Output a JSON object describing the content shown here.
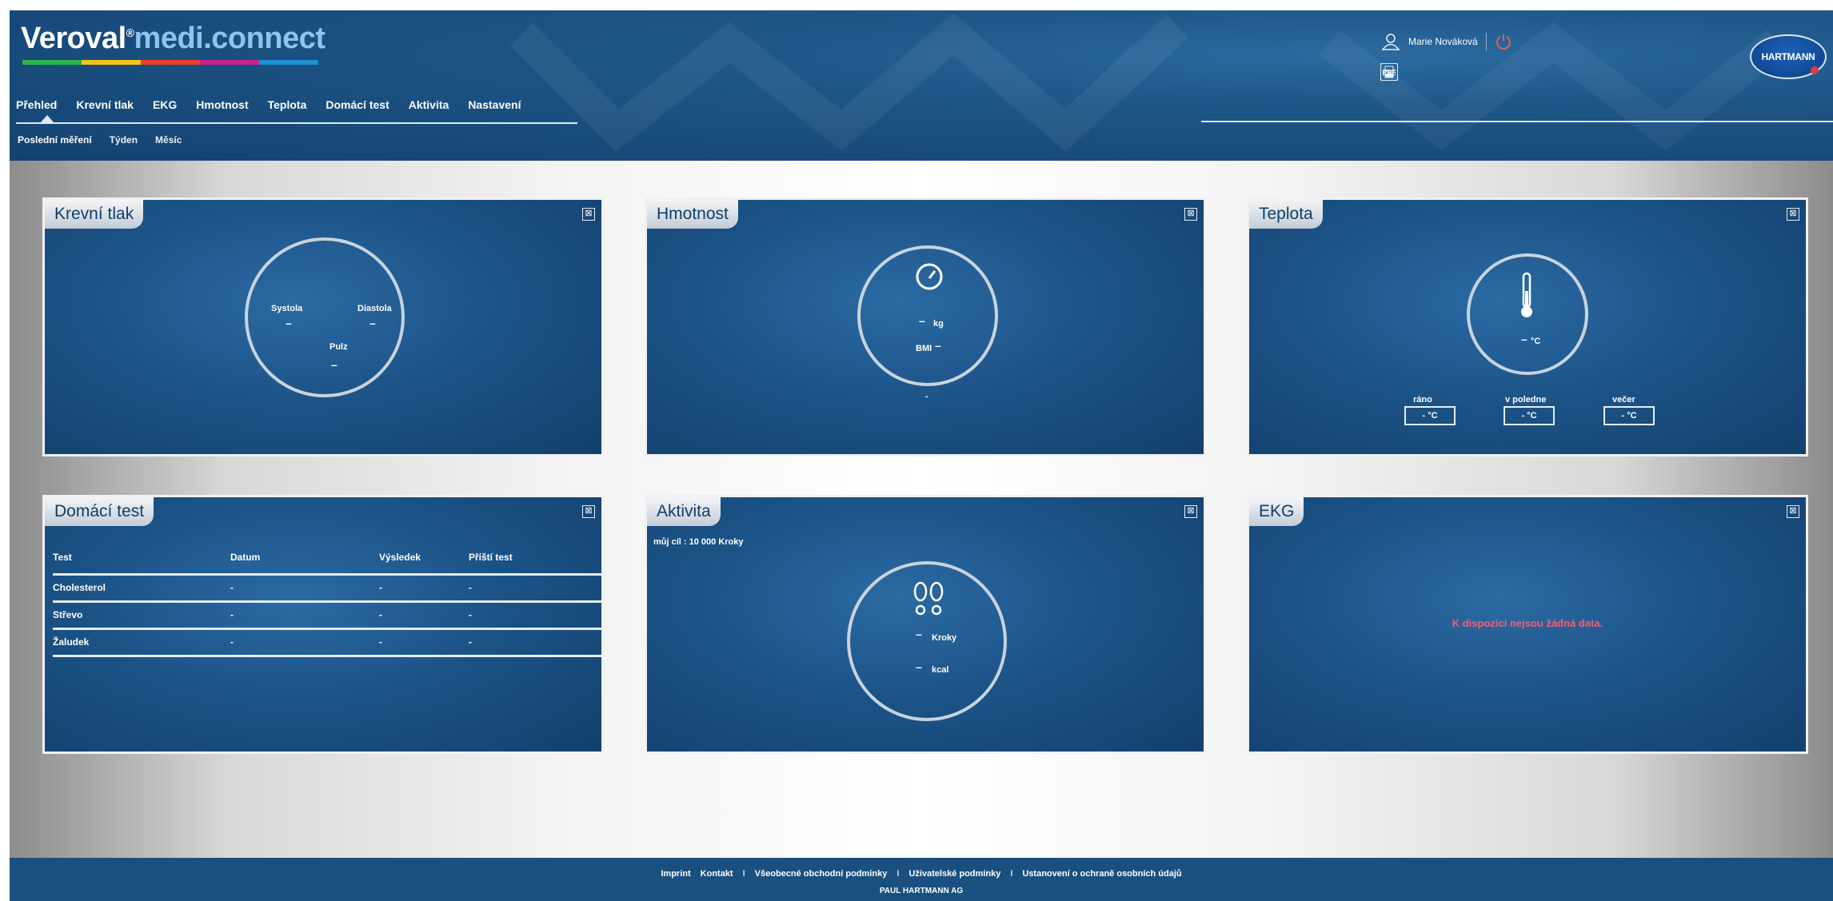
{
  "brand": {
    "name_part1": "Veroval",
    "reg": "®",
    "name_part2": "medi.connect",
    "bar_colors": [
      "#2bb34a",
      "#f5c518",
      "#e83e2a",
      "#c4238c",
      "#1f8fd6"
    ],
    "company_logo": "HARTMANN"
  },
  "nav": {
    "items": [
      "Přehled",
      "Krevní tlak",
      "EKG",
      "Hmotnost",
      "Teplota",
      "Domácí test",
      "Aktivita",
      "Nastavení"
    ],
    "sub_items": [
      "Poslední měření",
      "Týden",
      "Měsíc"
    ]
  },
  "user": {
    "name": "Marie Nováková",
    "icons": [
      "user-icon",
      "power-icon"
    ],
    "tool_icons": [
      "print-icon",
      "pdf-icon",
      "add-folder-icon",
      "document-icon"
    ],
    "tool_labels": [
      "",
      "PDF",
      "+",
      ""
    ]
  },
  "panels": {
    "blood_pressure": {
      "title": "Krevní tlak",
      "systola_label": "Systola",
      "systola_value": "–",
      "diastola_label": "Diastola",
      "diastola_value": "–",
      "pulz_label": "Pulz",
      "pulz_value": "–"
    },
    "weight": {
      "title": "Hmotnost",
      "value": "–",
      "unit": "kg",
      "bmi_label": "BMI",
      "bmi_value": "–",
      "date": "-"
    },
    "temperature": {
      "title": "Teplota",
      "value": "–",
      "unit": "°C",
      "morning_label": "ráno",
      "noon_label": "v poledne",
      "evening_label": "večer",
      "morning_value": "- °C",
      "noon_value": "- °C",
      "evening_value": "- °C"
    },
    "home_test": {
      "title": "Domácí test",
      "columns": [
        "Test",
        "Datum",
        "Výsledek",
        "Příští test"
      ],
      "rows": [
        [
          "Cholesterol",
          "-",
          "-",
          "-"
        ],
        [
          "Střevo",
          "-",
          "-",
          "-"
        ],
        [
          "Žaludek",
          "-",
          "-",
          "-"
        ]
      ]
    },
    "activity": {
      "title": "Aktivita",
      "goal": "můj cíl : 10 000  Kroky",
      "steps_value": "–",
      "steps_unit": "Kroky",
      "kcal_value": "–",
      "kcal_unit": "kcal"
    },
    "ekg": {
      "title": "EKG",
      "message": "K dispozici nejsou žádná data."
    }
  },
  "footer": {
    "links": [
      "Imprint",
      "Kontakt",
      "Všeobecné obchodní podmínky",
      "Uživatelské podmínky",
      "Ustanovení o ochraně osobních údajů"
    ],
    "separator": "I",
    "company": "PAUL HARTMANN AG"
  }
}
